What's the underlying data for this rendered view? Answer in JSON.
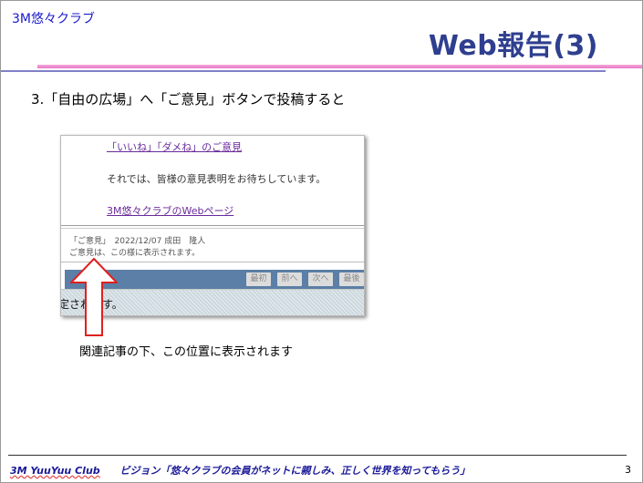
{
  "slide": {
    "brand": "3M悠々クラブ",
    "title": "Web報告(3)",
    "heading": "3.「自由の広場」へ「ご意見」ボタンで投稿すると",
    "caption": "関連記事の下、この位置に表示されます",
    "footer": {
      "club": "3M YuuYuu Club",
      "vision": "ビジョン「悠々クラブの会員がネットに親しみ、正しく世界を知ってもらう」"
    },
    "page_number": "3"
  },
  "screenshot": {
    "link1": "「いいね」「ダメね」のご意見",
    "paragraph": "それでは、皆様の意見表明をお待ちしています。",
    "link2": "3M悠々クラブのWebページ",
    "comment_meta": "「ご意見」　2022/12/07 成田　隆人",
    "comment_body": "ご意見は、この様に表示されます。",
    "pager": [
      "最初",
      "前へ",
      "次へ",
      "最後"
    ],
    "footer_text": "定されます。"
  },
  "colors": {
    "title": "#2f3f8f",
    "brand": "#1a1acc",
    "arrow": "#e02020",
    "pager_bar": "#5b7fa6",
    "link": "#6a2a9a"
  },
  "icons": {
    "arrow": "up-arrow-icon"
  }
}
